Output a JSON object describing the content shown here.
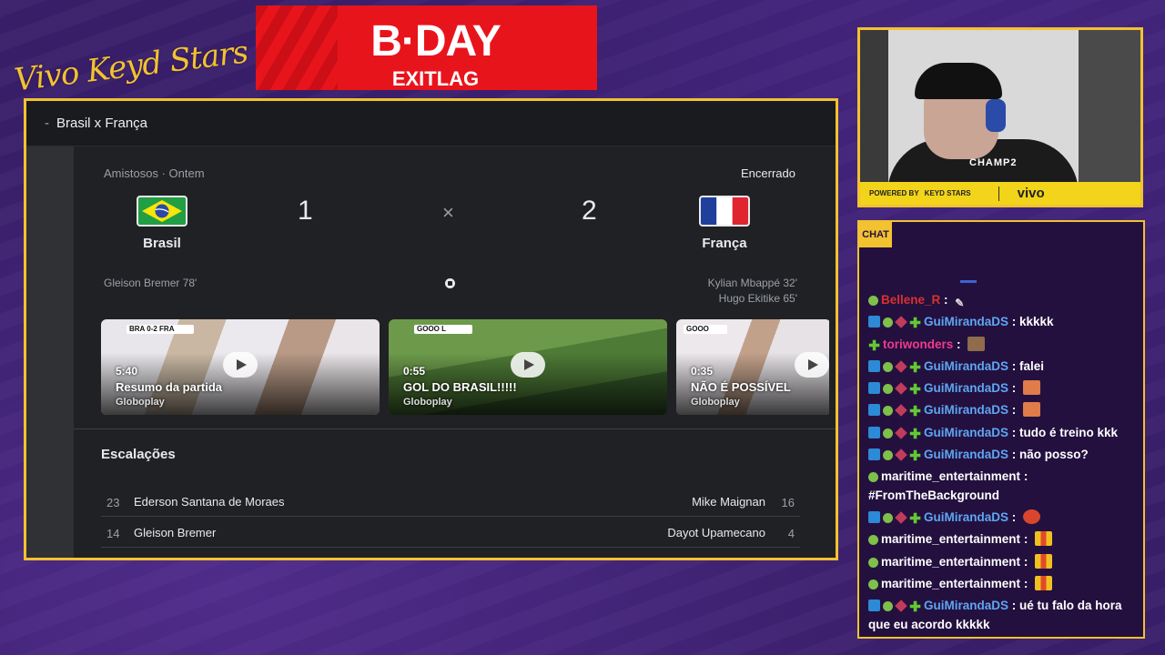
{
  "overlay": {
    "logo_script": "Vivo Keyd Stars",
    "banner_top": "B·DAY",
    "banner_bottom": "EXITLAG"
  },
  "page": {
    "header_title": "Brasil x França"
  },
  "match": {
    "competition": "Amistosos · Ontem",
    "status": "Encerrado",
    "home": {
      "name": "Brasil",
      "score": "1",
      "scorers": [
        "Gleison Bremer 78'"
      ]
    },
    "away": {
      "name": "França",
      "score": "2",
      "scorers": [
        "Kylian Mbappé 32'",
        "Hugo Ekitike 65'"
      ]
    },
    "separator": "×"
  },
  "videos": [
    {
      "duration": "5:40",
      "title": "Resumo da partida",
      "source": "Globoplay"
    },
    {
      "duration": "0:55",
      "title": "GOL DO BRASIL!!!!!",
      "source": "Globoplay"
    },
    {
      "duration": "0:35",
      "title": "NÃO É POSSÍVEL",
      "source": "Globoplay"
    }
  ],
  "lineups": {
    "title": "Escalações",
    "rows": [
      {
        "home_num": "23",
        "home_name": "Ederson Santana de Moraes",
        "away_name": "Mike Maignan",
        "away_num": "16"
      },
      {
        "home_num": "14",
        "home_name": "Gleison Bremer",
        "away_name": "Dayot Upamecano",
        "away_num": "4"
      }
    ]
  },
  "cam": {
    "tag": "CHAMP2",
    "powered_by": "POWERED BY",
    "keyd": "KEYD STARS",
    "vivo": "vivo"
  },
  "chat": {
    "label": "CHAT",
    "messages": [
      {
        "user": "Bellene_R",
        "text": "",
        "color": "red",
        "badges": [
          "check"
        ],
        "emote": "feather"
      },
      {
        "user": "GuiMirandaDS",
        "text": "kkkkk",
        "color": "blue",
        "badges": [
          "prime",
          "check",
          "gift",
          "plus"
        ]
      },
      {
        "user": "toriwonders",
        "text": "",
        "color": "pink",
        "badges": [
          "plus"
        ],
        "emote": "face"
      },
      {
        "user": "GuiMirandaDS",
        "text": "falei",
        "color": "blue",
        "badges": [
          "prime",
          "check",
          "gift",
          "plus"
        ]
      },
      {
        "user": "GuiMirandaDS",
        "text": "",
        "color": "blue",
        "badges": [
          "prime",
          "check",
          "gift",
          "plus"
        ],
        "emote": "box"
      },
      {
        "user": "GuiMirandaDS",
        "text": "",
        "color": "blue",
        "badges": [
          "prime",
          "check",
          "gift",
          "plus"
        ],
        "emote": "box"
      },
      {
        "user": "GuiMirandaDS",
        "text": "tudo é treino kkk",
        "color": "blue",
        "badges": [
          "prime",
          "check",
          "gift",
          "plus"
        ]
      },
      {
        "user": "GuiMirandaDS",
        "text": "não posso?",
        "color": "blue",
        "badges": [
          "prime",
          "check",
          "gift",
          "plus"
        ]
      },
      {
        "user": "maritime_entertainment",
        "text": "#FromTheBackground",
        "color": "white",
        "badges": [
          "check"
        ]
      },
      {
        "user": "GuiMirandaDS",
        "text": "",
        "color": "blue",
        "badges": [
          "prime",
          "check",
          "gift",
          "plus"
        ],
        "emote": "mad"
      },
      {
        "user": "maritime_entertainment",
        "text": "",
        "color": "white",
        "badges": [
          "check"
        ],
        "emote": "bars"
      },
      {
        "user": "maritime_entertainment",
        "text": "",
        "color": "white",
        "badges": [
          "check"
        ],
        "emote": "bars"
      },
      {
        "user": "maritime_entertainment",
        "text": "",
        "color": "white",
        "badges": [
          "check"
        ],
        "emote": "bars"
      },
      {
        "user": "GuiMirandaDS",
        "text": "ué tu falo da hora que eu acordo kkkkk",
        "color": "blue",
        "badges": [
          "prime",
          "check",
          "gift",
          "plus"
        ]
      }
    ]
  }
}
